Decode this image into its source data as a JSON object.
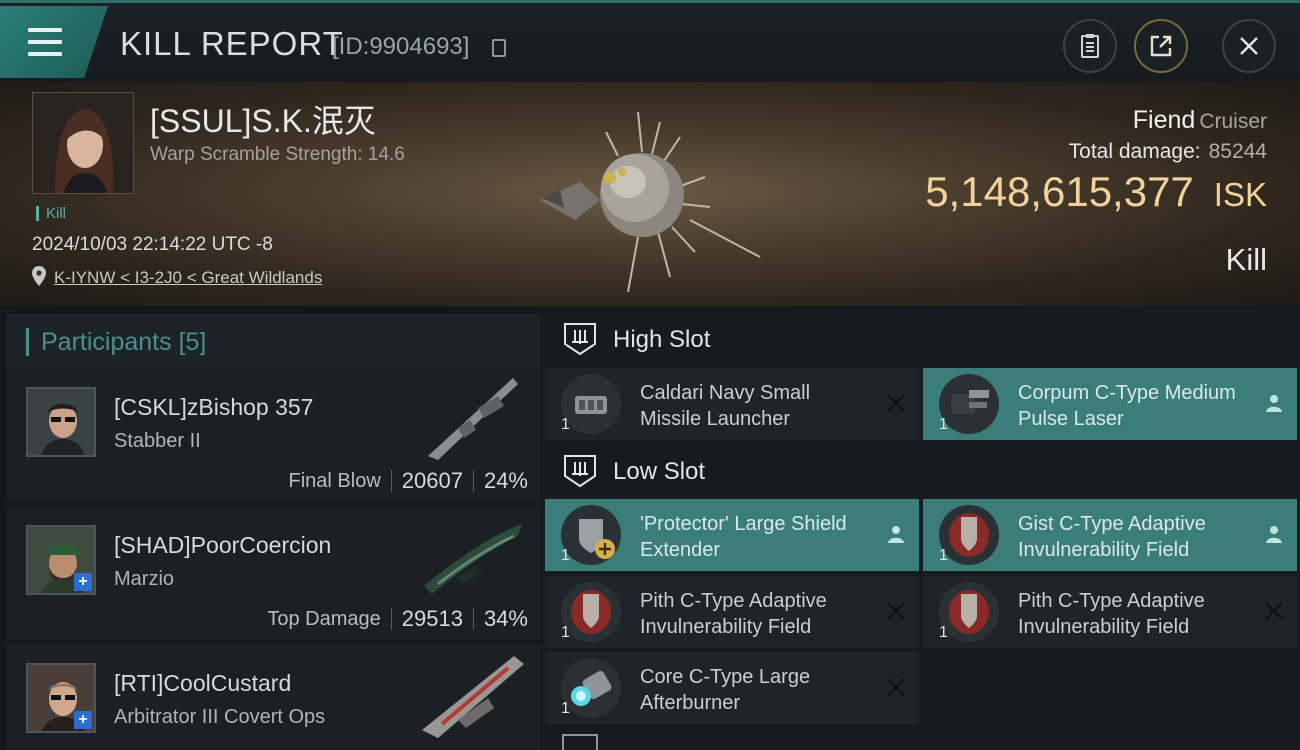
{
  "header": {
    "title": "KILL REPORT",
    "report_id": "[ID:9904693]",
    "buttons": {
      "clipboard": "clipboard-icon",
      "share": "share-icon",
      "close": "close-icon"
    }
  },
  "victim": {
    "name": "[SSUL]S.K.泯灭",
    "warp_scramble": "Warp Scramble Strength: 14.6",
    "result_tag": "Kill",
    "datetime": "2024/10/03 22:14:22 UTC -8",
    "location": "K-IYNW < I3-2J0 < Great Wildlands",
    "ship_name": "Fiend",
    "ship_class": "Cruiser",
    "total_damage_label": "Total damage:",
    "total_damage": "85244",
    "isk_value": "5,148,615,377",
    "isk_unit": "ISK",
    "result": "Kill"
  },
  "participants": {
    "label": "Participants",
    "count": "[5]",
    "items": [
      {
        "name": "[CSKL]zBishop 357",
        "ship": "Stabber II",
        "stat_label": "Final Blow",
        "damage": "20607",
        "percent": "24%"
      },
      {
        "name": "[SHAD]PoorCoercion",
        "ship": "Marzio",
        "stat_label": "Top Damage",
        "damage": "29513",
        "percent": "34%"
      },
      {
        "name": "[RTI]CoolCustard",
        "ship": "Arbitrator III Covert Ops"
      }
    ]
  },
  "slots": {
    "high": {
      "label": "High Slot",
      "modules": [
        {
          "name": "Caldari Navy Small Missile Launcher",
          "qty": "1",
          "status": "destroyed"
        },
        {
          "name": "Corpum C-Type Medium Pulse Laser",
          "qty": "1",
          "status": "dropped"
        }
      ]
    },
    "low": {
      "label": "Low Slot",
      "modules": [
        {
          "name": "'Protector' Large Shield Extender",
          "qty": "1",
          "status": "dropped"
        },
        {
          "name": "Gist C-Type Adaptive Invulnerability Field",
          "qty": "1",
          "status": "dropped"
        },
        {
          "name": "Pith C-Type Adaptive Invulnerability Field",
          "qty": "1",
          "status": "destroyed"
        },
        {
          "name": "Pith C-Type Adaptive Invulnerability Field",
          "qty": "1",
          "status": "destroyed"
        },
        {
          "name": "Core C-Type Large Afterburner",
          "qty": "1",
          "status": "destroyed"
        }
      ]
    }
  },
  "colors": {
    "accent": "#3a7d79",
    "isk": "#f2d29a",
    "teal_text": "#4d8f8a"
  }
}
